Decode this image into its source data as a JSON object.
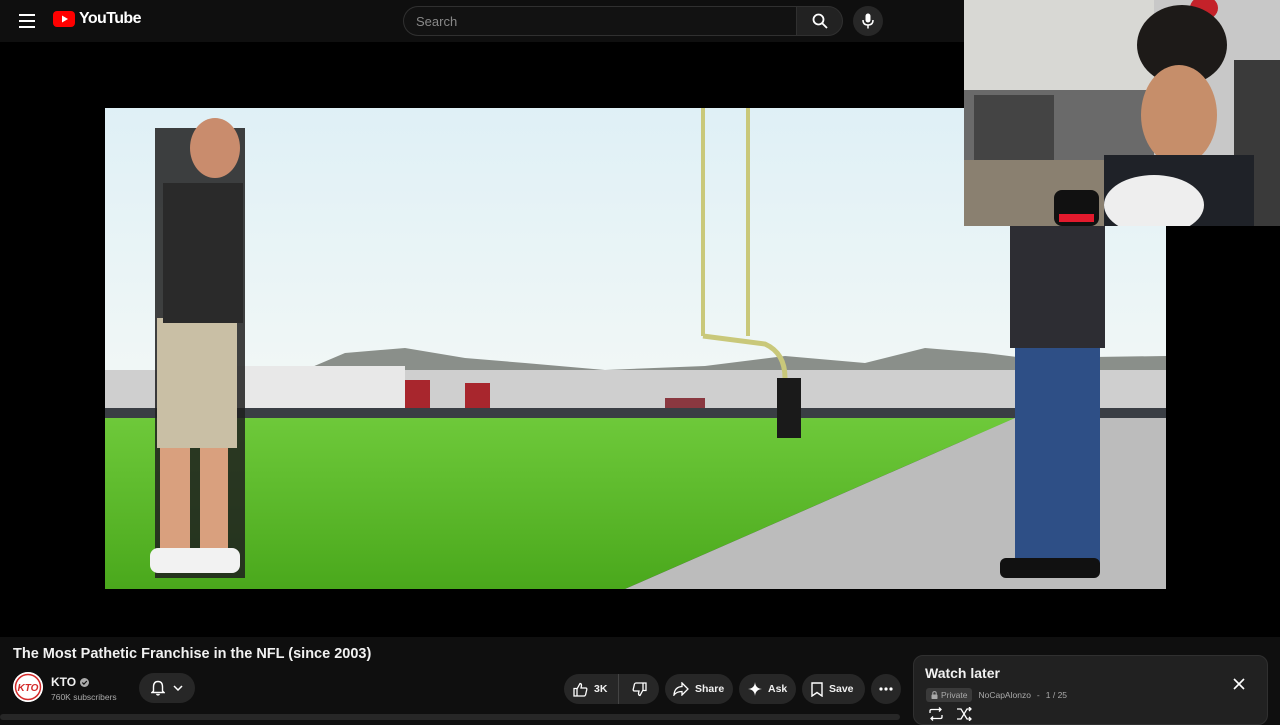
{
  "header": {
    "logo_text": "YouTube",
    "search_placeholder": "Search",
    "icons": [
      "menu-icon",
      "youtube-logo-icon",
      "search-icon",
      "mic-icon"
    ]
  },
  "video": {
    "title": "The Most Pathetic Franchise in the NFL (since 2003)"
  },
  "channel": {
    "name": "KTO",
    "subscribers": "760K subscribers",
    "verified": true,
    "avatar_text": "KTO"
  },
  "actions": {
    "likes": "3K",
    "share_label": "Share",
    "ask_label": "Ask",
    "save_label": "Save"
  },
  "watch_later": {
    "title": "Watch later",
    "privacy": "Private",
    "owner": "NoCapAlonzo",
    "position": "1 / 25"
  },
  "colors": {
    "background": "#0f0f0f",
    "brand_red": "#ff0000",
    "pill": "#272727",
    "panel": "#212121"
  }
}
